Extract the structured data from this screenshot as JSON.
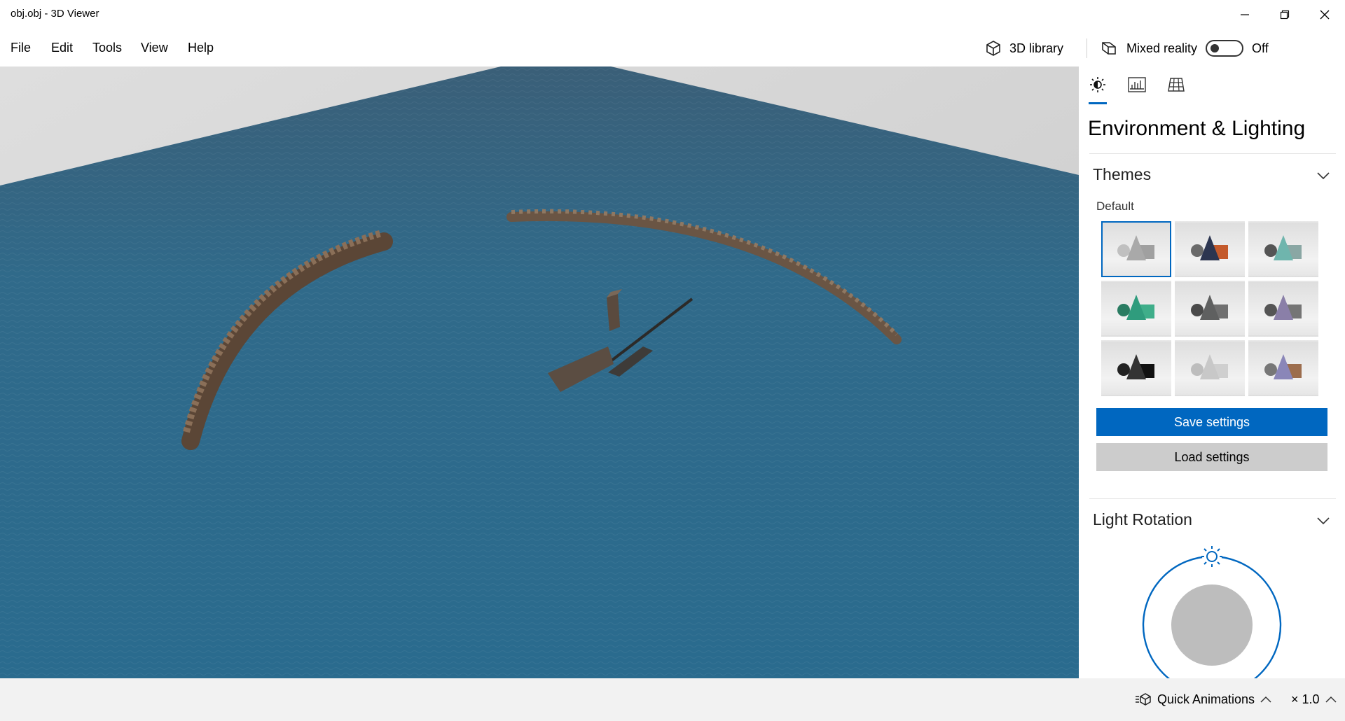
{
  "window": {
    "title": "obj.obj - 3D Viewer"
  },
  "menu": {
    "items": [
      "File",
      "Edit",
      "Tools",
      "View",
      "Help"
    ]
  },
  "toolbar": {
    "library_label": "3D library",
    "mixed_reality_label": "Mixed reality",
    "mixed_reality_state": "Off"
  },
  "panel": {
    "title": "Environment & Lighting",
    "themes_header": "Themes",
    "themes_group_label": "Default",
    "themes": [
      {
        "shape": "#a9a9a9",
        "box": "#a0a0a0",
        "sphere": "#c0c0c0",
        "selected": true
      },
      {
        "shape": "#2c3550",
        "box": "#c45a2c",
        "sphere": "#6a6a6a",
        "selected": false
      },
      {
        "shape": "#6fb5ad",
        "box": "#8aa7a4",
        "sphere": "#555555",
        "selected": false
      },
      {
        "shape": "#2f9c7d",
        "box": "#3fae8a",
        "sphere": "#2a7c62",
        "selected": false
      },
      {
        "shape": "#5f6060",
        "box": "#707070",
        "sphere": "#4a4a4a",
        "selected": false
      },
      {
        "shape": "#8a7fa8",
        "box": "#757575",
        "sphere": "#555555",
        "selected": false
      },
      {
        "shape": "#333333",
        "box": "#111111",
        "sphere": "#222222",
        "selected": false
      },
      {
        "shape": "#c8c8c8",
        "box": "#cfcfcf",
        "sphere": "#bdbdbd",
        "selected": false
      },
      {
        "shape": "#8a86b8",
        "box": "#9c6d4d",
        "sphere": "#777777",
        "selected": false
      }
    ],
    "save_label": "Save settings",
    "load_label": "Load settings",
    "light_rotation_header": "Light Rotation"
  },
  "status": {
    "quick_animations_label": "Quick Animations",
    "speed_label": "× 1.0"
  },
  "colors": {
    "accent": "#0067c0",
    "ocean": "#2f6685",
    "sky": "#d4d4d4"
  }
}
